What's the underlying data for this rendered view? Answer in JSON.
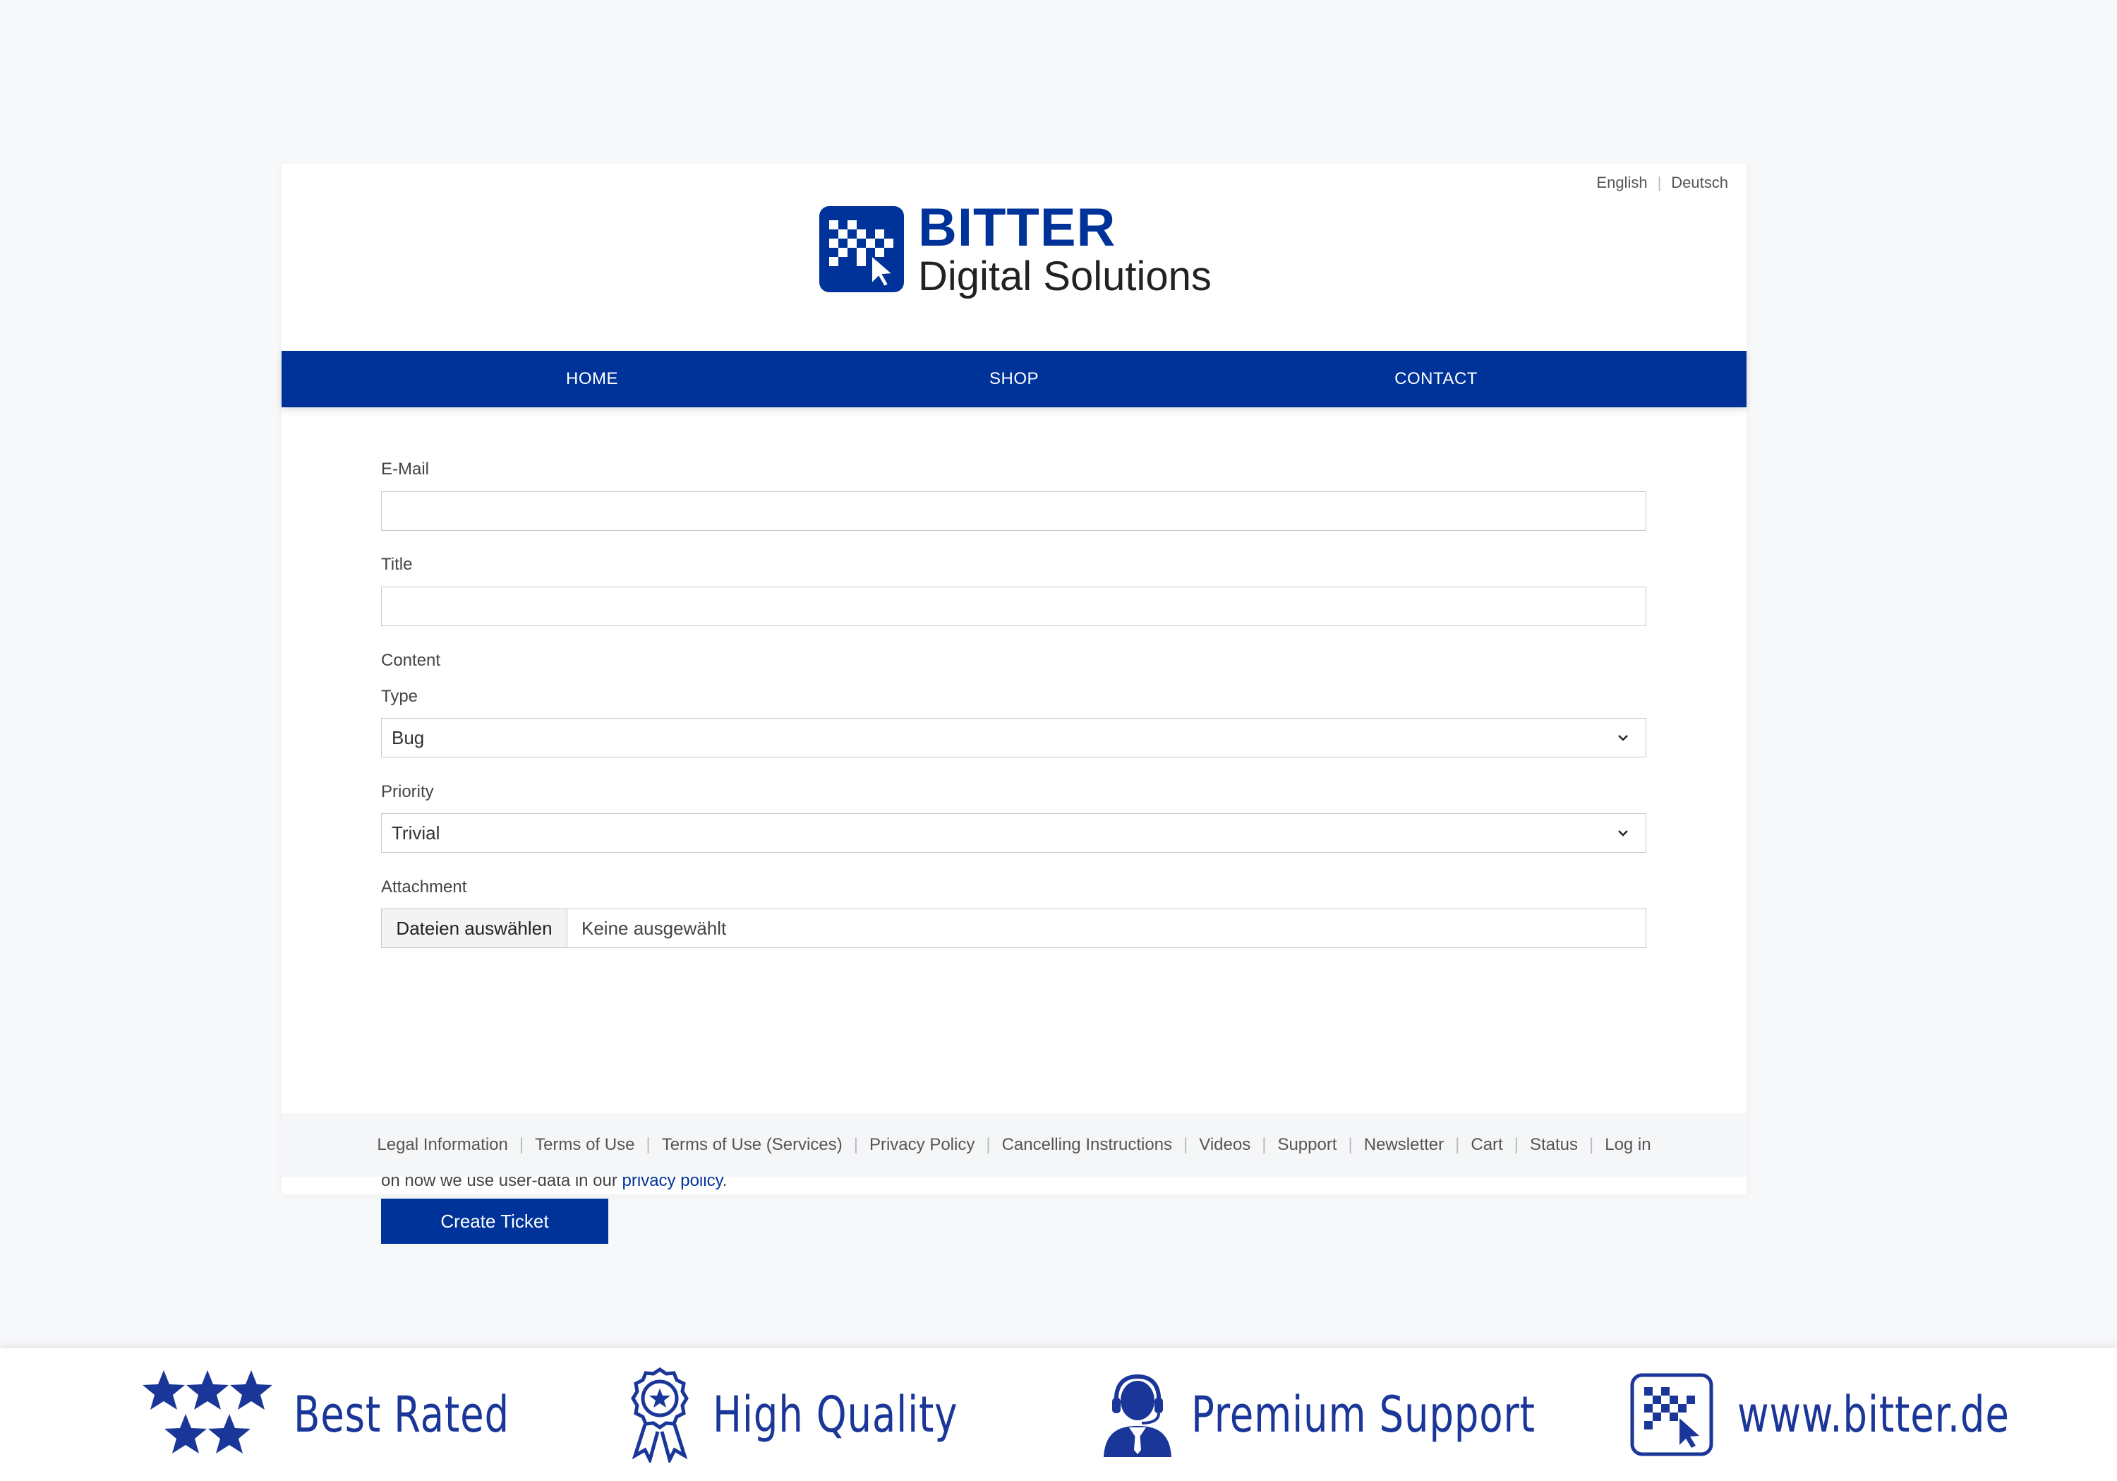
{
  "colors": {
    "brand": "#003399",
    "page_bg": "#f7f8fa",
    "card_bg": "#ffffff"
  },
  "languages": [
    "English",
    "Deutsch"
  ],
  "logo": {
    "line1": "BITTER",
    "line2": "Digital Solutions",
    "icon": "bitter-logo-icon"
  },
  "nav": [
    "HOME",
    "SHOP",
    "CONTACT"
  ],
  "form": {
    "email_label": "E-Mail",
    "email_value": "",
    "title_label": "Title",
    "title_value": "",
    "content_label": "Content",
    "type_label": "Type",
    "type_value": "Bug",
    "priority_label": "Priority",
    "priority_value": "Trivial",
    "attachment_label": "Attachment",
    "file_button": "Dateien auswählen",
    "file_status": "Keine ausgewählt",
    "consent_text": "I hereby acknowledge that the data collected in this form will be stored for further use and deleted once my inquiry has been processed. See more detailed information on how we use user-data in our ",
    "consent_link": "privacy policy",
    "consent_end": ".",
    "submit": "Create Ticket"
  },
  "footer": [
    "Legal Information",
    "Terms of Use",
    "Terms of Use (Services)",
    "Privacy Policy",
    "Cancelling Instructions",
    "Videos",
    "Support",
    "Newsletter",
    "Cart",
    "Status",
    "Log in"
  ],
  "badges": [
    {
      "icon": "stars-icon",
      "label": "Best Rated"
    },
    {
      "icon": "award-ribbon-icon",
      "label": "High Quality"
    },
    {
      "icon": "support-agent-icon",
      "label": "Premium Support"
    },
    {
      "icon": "bitter-logo-icon",
      "label": "www.bitter.de"
    }
  ]
}
